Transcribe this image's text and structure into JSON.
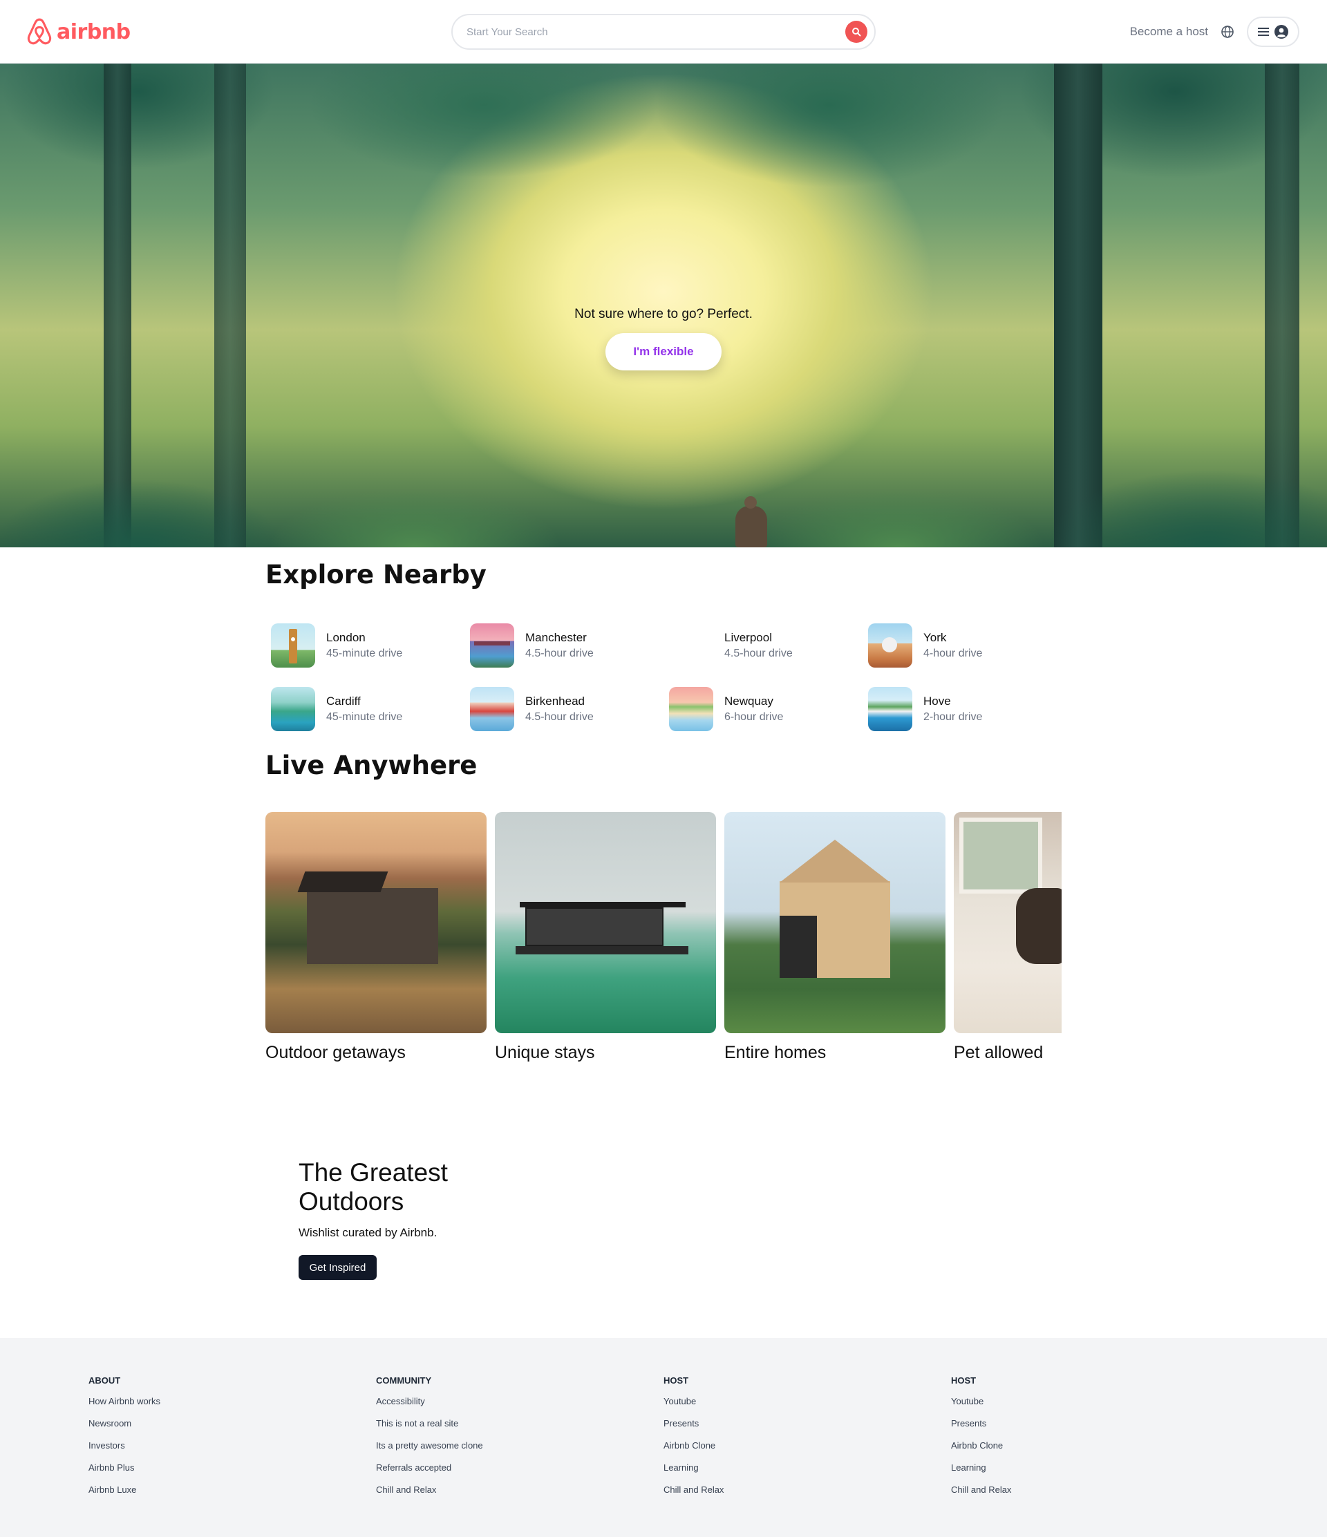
{
  "header": {
    "logo_text": "airbnb",
    "search_placeholder": "Start Your Search",
    "become_host": "Become a host"
  },
  "hero": {
    "title": "Not sure where to go? Perfect.",
    "button": "I'm flexible"
  },
  "explore": {
    "title": "Explore Nearby",
    "items": [
      {
        "city": "London",
        "distance": "45-minute drive"
      },
      {
        "city": "Manchester",
        "distance": "4.5-hour drive"
      },
      {
        "city": "Liverpool",
        "distance": "4.5-hour drive"
      },
      {
        "city": "York",
        "distance": "4-hour drive"
      },
      {
        "city": "Cardiff",
        "distance": "45-minute drive"
      },
      {
        "city": "Birkenhead",
        "distance": "4.5-hour drive"
      },
      {
        "city": "Newquay",
        "distance": "6-hour drive"
      },
      {
        "city": "Hove",
        "distance": "2-hour drive"
      }
    ]
  },
  "live": {
    "title": "Live Anywhere",
    "cards": [
      {
        "label": "Outdoor getaways"
      },
      {
        "label": "Unique stays"
      },
      {
        "label": "Entire homes"
      },
      {
        "label": "Pet allowed"
      }
    ]
  },
  "outdoors": {
    "title": "The Greatest Outdoors",
    "subtitle": "Wishlist curated by Airbnb.",
    "button": "Get Inspired"
  },
  "footer": {
    "columns": [
      {
        "heading": "ABOUT",
        "links": [
          "How Airbnb works",
          "Newsroom",
          "Investors",
          "Airbnb Plus",
          "Airbnb Luxe"
        ]
      },
      {
        "heading": "COMMUNITY",
        "links": [
          "Accessibility",
          "This is not a real site",
          "Its a pretty awesome clone",
          "Referrals accepted",
          "Chill and Relax"
        ]
      },
      {
        "heading": "HOST",
        "links": [
          "Youtube",
          "Presents",
          "Airbnb Clone",
          "Learning",
          "Chill and Relax"
        ]
      },
      {
        "heading": "HOST",
        "links": [
          "Youtube",
          "Presents",
          "Airbnb Clone",
          "Learning",
          "Chill and Relax"
        ]
      }
    ]
  },
  "colors": {
    "brand": "#ff5a5f",
    "flexible_text": "#9333ea",
    "button_dark": "#111827",
    "footer_bg": "#f3f4f6"
  }
}
